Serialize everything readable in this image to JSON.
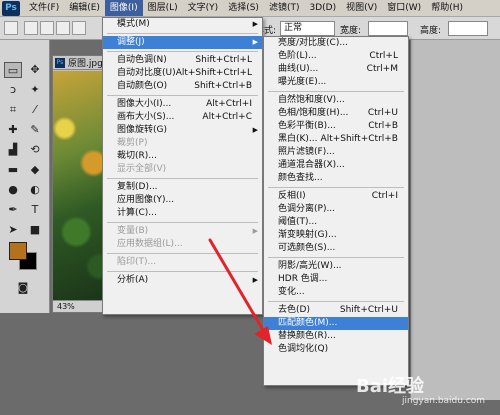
{
  "app": {
    "logo": "Ps"
  },
  "menubar": {
    "items": [
      "文件(F)",
      "编辑(E)",
      "图像(I)",
      "图层(L)",
      "文字(Y)",
      "选择(S)",
      "滤镜(T)",
      "3D(D)",
      "视图(V)",
      "窗口(W)",
      "帮助(H)"
    ]
  },
  "options": {
    "style_label": "样式:",
    "style_value": "正常",
    "width_label": "宽度:",
    "height_label": "高度:"
  },
  "document": {
    "tab_title": "原图.jpg",
    "zoom": "43%"
  },
  "image_menu": {
    "items": [
      {
        "label": "模式(M)",
        "shortcut": "",
        "submenu": true,
        "disabled": false
      },
      {
        "sep": true
      },
      {
        "label": "调整(J)",
        "shortcut": "",
        "submenu": true,
        "disabled": false,
        "highlight": true
      },
      {
        "sep": true
      },
      {
        "label": "自动色调(N)",
        "shortcut": "Shift+Ctrl+L",
        "disabled": false
      },
      {
        "label": "自动对比度(U)",
        "shortcut": "Alt+Shift+Ctrl+L",
        "disabled": false
      },
      {
        "label": "自动颜色(O)",
        "shortcut": "Shift+Ctrl+B",
        "disabled": false
      },
      {
        "sep": true
      },
      {
        "label": "图像大小(I)...",
        "shortcut": "Alt+Ctrl+I",
        "disabled": false
      },
      {
        "label": "画布大小(S)...",
        "shortcut": "Alt+Ctrl+C",
        "disabled": false
      },
      {
        "label": "图像旋转(G)",
        "shortcut": "",
        "submenu": true,
        "disabled": false
      },
      {
        "label": "裁剪(P)",
        "shortcut": "",
        "disabled": true
      },
      {
        "label": "裁切(R)...",
        "shortcut": "",
        "disabled": false
      },
      {
        "label": "显示全部(V)",
        "shortcut": "",
        "disabled": true
      },
      {
        "sep": true
      },
      {
        "label": "复制(D)...",
        "shortcut": "",
        "disabled": false
      },
      {
        "label": "应用图像(Y)...",
        "shortcut": "",
        "disabled": false
      },
      {
        "label": "计算(C)...",
        "shortcut": "",
        "disabled": false
      },
      {
        "sep": true
      },
      {
        "label": "变量(B)",
        "shortcut": "",
        "submenu": true,
        "disabled": true
      },
      {
        "label": "应用数据组(L)...",
        "shortcut": "",
        "disabled": true
      },
      {
        "sep": true
      },
      {
        "label": "陷印(T)...",
        "shortcut": "",
        "disabled": true
      },
      {
        "sep": true
      },
      {
        "label": "分析(A)",
        "shortcut": "",
        "submenu": true,
        "disabled": false
      }
    ]
  },
  "adjust_menu": {
    "items": [
      {
        "label": "亮度/对比度(C)...",
        "shortcut": ""
      },
      {
        "label": "色阶(L)...",
        "shortcut": "Ctrl+L"
      },
      {
        "label": "曲线(U)...",
        "shortcut": "Ctrl+M"
      },
      {
        "label": "曝光度(E)...",
        "shortcut": ""
      },
      {
        "sep": true
      },
      {
        "label": "自然饱和度(V)...",
        "shortcut": ""
      },
      {
        "label": "色相/饱和度(H)...",
        "shortcut": "Ctrl+U"
      },
      {
        "label": "色彩平衡(B)...",
        "shortcut": "Ctrl+B"
      },
      {
        "label": "黑白(K)...",
        "shortcut": "Alt+Shift+Ctrl+B"
      },
      {
        "label": "照片滤镜(F)...",
        "shortcut": ""
      },
      {
        "label": "通道混合器(X)...",
        "shortcut": ""
      },
      {
        "label": "颜色查找...",
        "shortcut": ""
      },
      {
        "sep": true
      },
      {
        "label": "反相(I)",
        "shortcut": "Ctrl+I"
      },
      {
        "label": "色调分离(P)...",
        "shortcut": ""
      },
      {
        "label": "阈值(T)...",
        "shortcut": ""
      },
      {
        "label": "渐变映射(G)...",
        "shortcut": ""
      },
      {
        "label": "可选颜色(S)...",
        "shortcut": ""
      },
      {
        "sep": true
      },
      {
        "label": "阴影/高光(W)...",
        "shortcut": ""
      },
      {
        "label": "HDR 色调...",
        "shortcut": ""
      },
      {
        "label": "变化...",
        "shortcut": ""
      },
      {
        "sep": true
      },
      {
        "label": "去色(D)",
        "shortcut": "Shift+Ctrl+U"
      },
      {
        "label": "匹配颜色(M)...",
        "shortcut": "",
        "highlight": true
      },
      {
        "label": "替换颜色(R)...",
        "shortcut": ""
      },
      {
        "label": "色调均化(Q)",
        "shortcut": ""
      }
    ]
  },
  "watermark": {
    "logo": "Bai经验",
    "text": "经验",
    "url": "jingyan.baidu.com"
  },
  "colors": {
    "accent_highlight": "#3d80d6",
    "menu_active": "#3d5f9d",
    "arrow": "#e0242a",
    "fg_swatch": "#b5711c"
  }
}
